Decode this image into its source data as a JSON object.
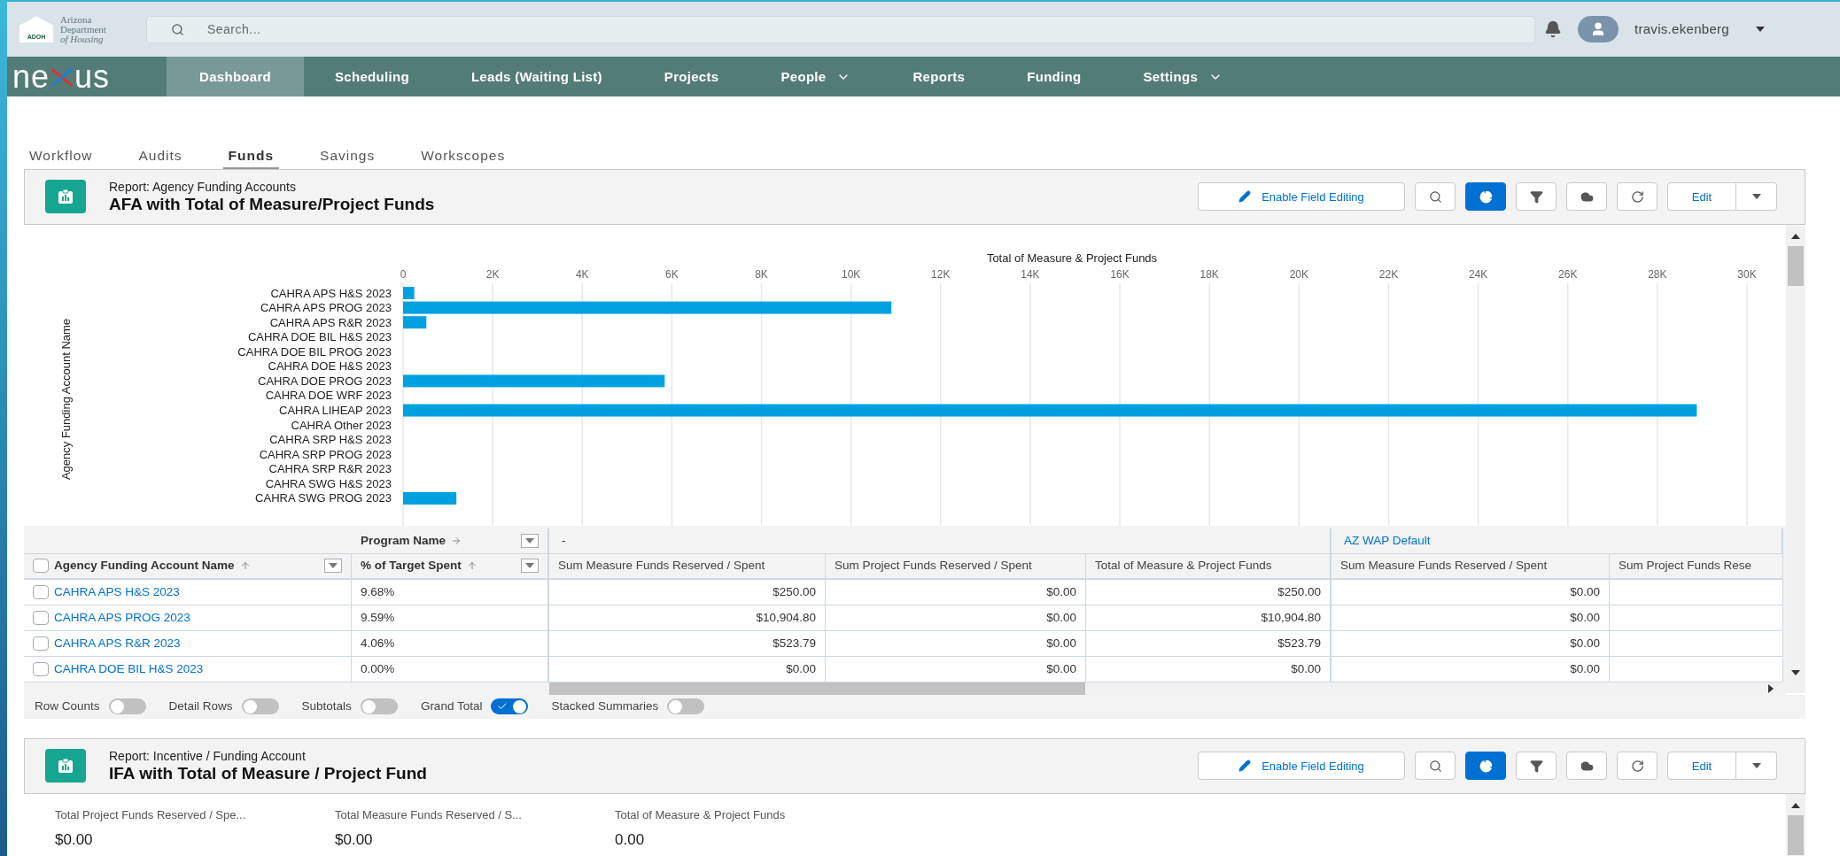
{
  "header": {
    "logo_lines": [
      "Arizona",
      "Department",
      "of Housing"
    ],
    "logo_badge": "ADOH",
    "search": {
      "placeholder": "Search..."
    },
    "username": "travis.ekenberg"
  },
  "nav": {
    "brand_left": "ne",
    "brand_right": "us",
    "items": [
      {
        "label": "Dashboard",
        "selected": true,
        "has_menu": false
      },
      {
        "label": "Scheduling",
        "selected": false,
        "has_menu": false
      },
      {
        "label": "Leads (Waiting List)",
        "selected": false,
        "has_menu": false
      },
      {
        "label": "Projects",
        "selected": false,
        "has_menu": false
      },
      {
        "label": "People",
        "selected": false,
        "has_menu": true
      },
      {
        "label": "Reports",
        "selected": false,
        "has_menu": false
      },
      {
        "label": "Funding",
        "selected": false,
        "has_menu": false
      },
      {
        "label": "Settings",
        "selected": false,
        "has_menu": true
      }
    ]
  },
  "tabs": [
    {
      "label": "Workflow",
      "selected": false
    },
    {
      "label": "Audits",
      "selected": false
    },
    {
      "label": "Funds",
      "selected": true
    },
    {
      "label": "Savings",
      "selected": false
    },
    {
      "label": "Workscopes",
      "selected": false
    }
  ],
  "reports": [
    {
      "subtitle": "Report: Agency Funding Accounts",
      "title": "AFA with Total of Measure/Project Funds",
      "toolbar": {
        "edit_fields_label": "Enable Field Editing",
        "icon_buttons": [
          {
            "selected": false
          },
          {
            "selected": true
          },
          {
            "selected": false
          },
          {
            "selected": false
          },
          {
            "selected": false
          }
        ],
        "edit_label": "Edit"
      },
      "chart_data": {
        "type": "bar",
        "orientation": "horizontal",
        "grid": true,
        "title": "Total of Measure & Project Funds",
        "annotations": [
          {
            "text": "Agency Funding Account Name"
          }
        ],
        "categories": [
          "CAHRA APS H&S 2023",
          "CAHRA APS PROG 2023",
          "CAHRA APS R&R 2023",
          "CAHRA DOE BIL H&S 2023",
          "CAHRA DOE BIL PROG 2023",
          "CAHRA DOE H&S 2023",
          "CAHRA DOE PROG 2023",
          "CAHRA DOE WRF 2023",
          "CAHRA LIHEAP 2023",
          "CAHRA Other 2023",
          "CAHRA SRP H&S 2023",
          "CAHRA SRP PROG 2023",
          "CAHRA SRP R&R 2023",
          "CAHRA SWG H&S 2023",
          "CAHRA SWG PROG 2023"
        ],
        "series": [
          {
            "color": "#00a1e0",
            "values": [
              250,
              10900,
              520,
              0,
              0,
              0,
              5840,
              0,
              28880,
              0,
              0,
              0,
              0,
              0,
              1190
            ]
          }
        ],
        "xlim": [
          0,
          30000
        ],
        "xticks": [
          0,
          {
            "value": 2000,
            "label": "2K"
          },
          {
            "value": 4000,
            "label": "4K"
          },
          {
            "value": 6000,
            "label": "6K"
          },
          {
            "value": 8000,
            "label": "8K"
          },
          {
            "value": 10000,
            "label": "10K"
          },
          {
            "value": 12000,
            "label": "12K"
          },
          {
            "value": 14000,
            "label": "14K"
          },
          {
            "value": 16000,
            "label": "16K"
          },
          {
            "value": 18000,
            "label": "18K"
          },
          {
            "value": 20000,
            "label": "20K"
          },
          {
            "value": 22000,
            "label": "22K"
          },
          {
            "value": 24000,
            "label": "24K"
          },
          {
            "value": 26000,
            "label": "26K"
          },
          {
            "value": 28000,
            "label": "28K"
          },
          {
            "value": 30000,
            "label": "30K"
          }
        ]
      },
      "table": {
        "pivot_header": "Program Name",
        "select_all_checked": false,
        "groups": [
          {
            "label": "-",
            "kind": "plain"
          },
          {
            "label": "AZ WAP Default",
            "kind": "link"
          }
        ],
        "columns": [
          {
            "label": "Agency Funding Account Name",
            "sorted": true
          },
          {
            "label": "% of Target Spent",
            "sorted": true
          },
          {
            "label": "Sum Measure Funds Reserved / Spent",
            "sorted": false
          },
          {
            "label": "Sum Project Funds Reserved / Spent",
            "sorted": false
          },
          {
            "label": "Total of Measure & Project Funds",
            "sorted": false
          },
          {
            "label": "Sum Measure Funds Reserved / Spent",
            "sorted": false
          },
          {
            "label": "Sum Project Funds Rese",
            "sorted": false
          }
        ],
        "rows": [
          {
            "checked": false,
            "cells": [
              "CAHRA APS H&S 2023",
              "9.68%",
              "$250.00",
              "$0.00",
              "$250.00",
              "$0.00"
            ]
          },
          {
            "checked": false,
            "cells": [
              "CAHRA APS PROG 2023",
              "9.59%",
              "$10,904.80",
              "$0.00",
              "$10,904.80",
              "$0.00"
            ]
          },
          {
            "checked": false,
            "cells": [
              "CAHRA APS R&R 2023",
              "4.06%",
              "$523.79",
              "$0.00",
              "$523.79",
              "$0.00"
            ]
          },
          {
            "checked": false,
            "cells": [
              "CAHRA DOE BIL H&S 2023",
              "0.00%",
              "$0.00",
              "$0.00",
              "$0.00",
              "$0.00"
            ]
          }
        ]
      },
      "toggles": [
        {
          "label": "Row Counts",
          "on": false
        },
        {
          "label": "Detail Rows",
          "on": false
        },
        {
          "label": "Subtotals",
          "on": false
        },
        {
          "label": "Grand Total",
          "on": true
        },
        {
          "label": "Stacked Summaries",
          "on": false
        }
      ]
    },
    {
      "subtitle": "Report: Incentive / Funding Account",
      "title": "IFA with Total of Measure / Project Fund",
      "toolbar": {
        "edit_fields_label": "Enable Field Editing",
        "icon_buttons": [
          {
            "selected": false
          },
          {
            "selected": true
          },
          {
            "selected": false
          },
          {
            "selected": false
          },
          {
            "selected": false
          }
        ],
        "edit_label": "Edit"
      },
      "summary": [
        {
          "label": "Total Project Funds Reserved / Spe...",
          "value": "$0.00"
        },
        {
          "label": "Total Measure Funds Reserved / S...",
          "value": "$0.00"
        },
        {
          "label": "Total of Measure & Project Funds",
          "value": "0.00"
        }
      ]
    }
  ]
}
